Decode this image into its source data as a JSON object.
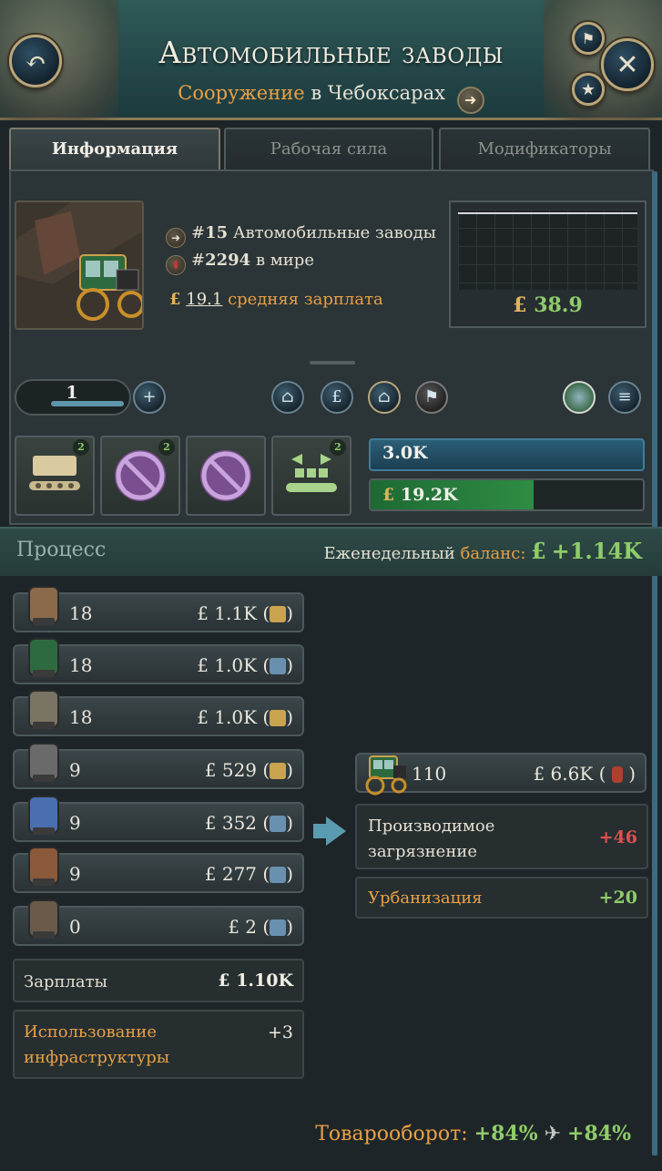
{
  "header": {
    "title": "Автомобильные заводы",
    "subtitle_type": "Сооружение",
    "subtitle_prep": "в",
    "subtitle_place": "Чебоксарах"
  },
  "tabs": [
    {
      "label": "Информация",
      "active": true
    },
    {
      "label": "Рабочая сила",
      "active": false
    },
    {
      "label": "Модификаторы",
      "active": false
    }
  ],
  "info": {
    "rank_national_prefix": "#",
    "rank_national": "15",
    "rank_national_label": "Автомобильные заводы",
    "rank_world_prefix": "#",
    "rank_world": "2294",
    "rank_world_label": "в мире",
    "currency": "£",
    "avg_wage": "19.1",
    "avg_wage_label": "средняя зарплата",
    "chart_value": "38.9"
  },
  "controls": {
    "level": "1"
  },
  "bars": {
    "employment": "3.0K",
    "cash_currency": "£",
    "cash": "19.2K",
    "cash_fill": 0.6
  },
  "production_methods": [
    {
      "name": "pm-tractor-assembly",
      "badge": "2"
    },
    {
      "name": "pm-no-aircraft",
      "badge": "2"
    },
    {
      "name": "pm-no-tanks",
      "badge": ""
    },
    {
      "name": "pm-automation",
      "badge": "2"
    }
  ],
  "process": {
    "title": "Процесс",
    "weekly_label": "Еженедельный",
    "weekly_label2": "баланс:",
    "currency": "£",
    "weekly_value": "+1.14K"
  },
  "inputs": [
    {
      "icon": "rubber-icon",
      "qty": "18",
      "value": "£ 1.1K (",
      "close": ")"
    },
    {
      "icon": "engines-icon",
      "qty": "18",
      "value": "£ 1.0K (",
      "close": ")"
    },
    {
      "icon": "oil-icon",
      "qty": "18",
      "value": "£ 1.0K (",
      "close": ")"
    },
    {
      "icon": "glass-icon",
      "qty": "9",
      "value": "£ 529 (",
      "close": ")"
    },
    {
      "icon": "electricity-icon",
      "qty": "9",
      "value": "£ 352 (",
      "close": ")"
    },
    {
      "icon": "tools-icon",
      "qty": "9",
      "value": "£ 277 (",
      "close": ")"
    },
    {
      "icon": "hammer-icon",
      "qty": "0",
      "value": "£ 2 (",
      "close": ")"
    }
  ],
  "wages": {
    "label": "Зарплаты",
    "value": "£ 1.10K"
  },
  "infra": {
    "label1": "Использование",
    "label2": "инфраструктуры",
    "value": "+3"
  },
  "output": {
    "qty": "110",
    "value": "£ 6.6K (",
    "close": ")"
  },
  "pollution": {
    "label1": "Производимое",
    "label2": "загрязнение",
    "value": "+46"
  },
  "urbanization": {
    "label": "Урбанизация",
    "value": "+20"
  },
  "turnover": {
    "label": "Товарооборот:",
    "value1": "+84%",
    "value2": "+84%"
  },
  "colors": {
    "gold": "#e1b45a",
    "orange": "#e8a045",
    "green": "#8fcc6a",
    "red": "#e05050"
  }
}
